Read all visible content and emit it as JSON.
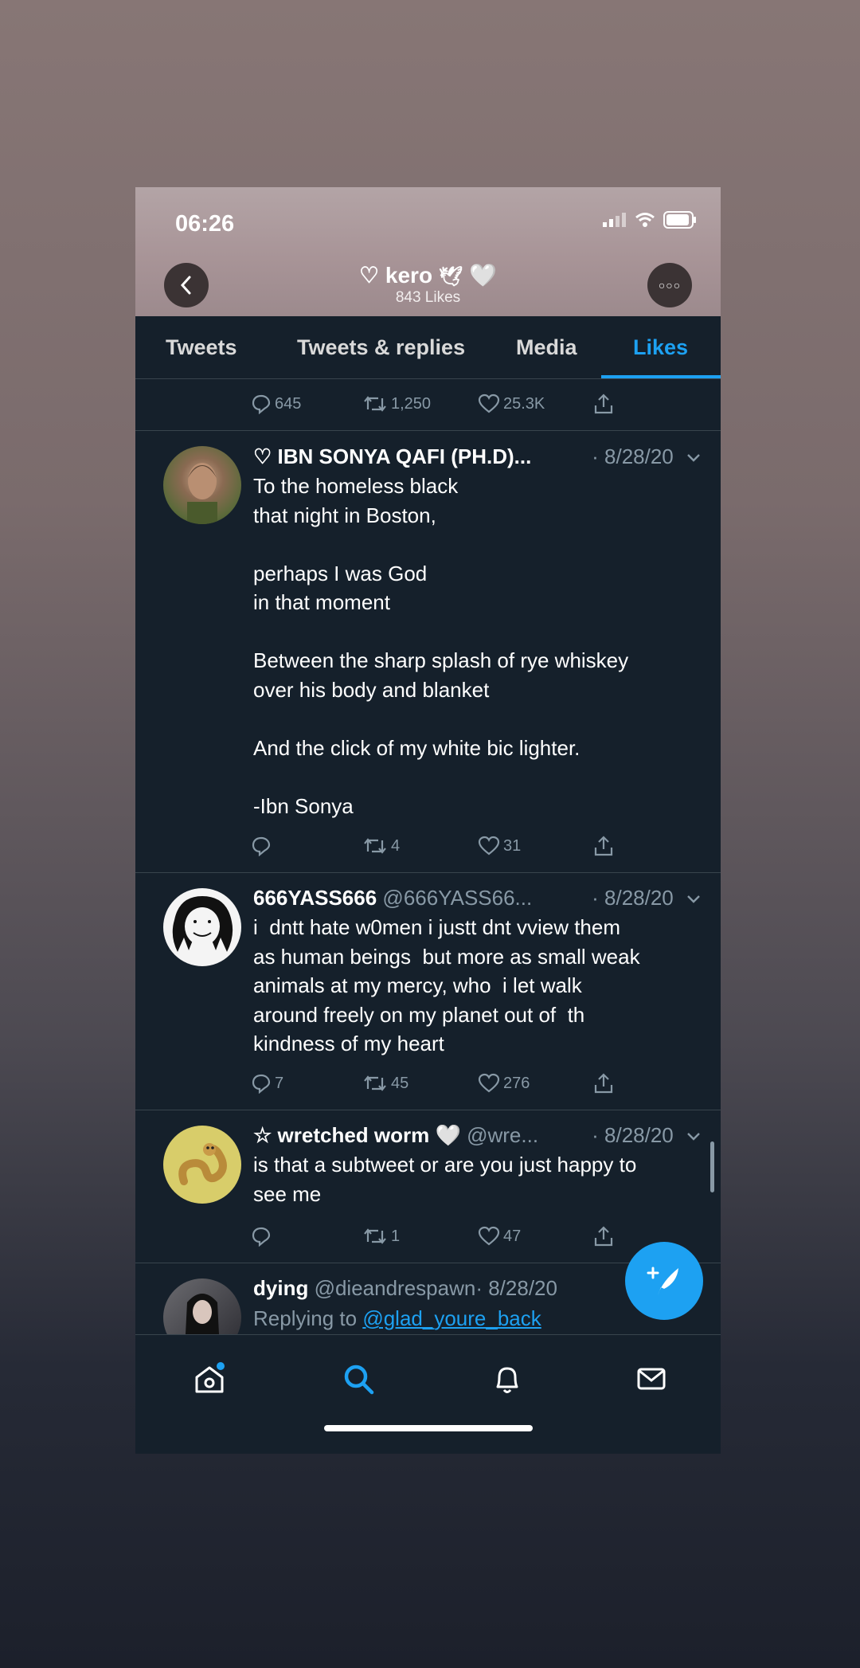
{
  "status": {
    "time": "06:26"
  },
  "profile": {
    "name": "♡ kero",
    "subtitle": "843 Likes"
  },
  "tabs": [
    {
      "label": "Tweets"
    },
    {
      "label": "Tweets & replies"
    },
    {
      "label": "Media"
    },
    {
      "label": "Likes"
    }
  ],
  "active_tab": "Likes",
  "top_actions": {
    "replies": "645",
    "retweets": "1,250",
    "likes": "25.3K"
  },
  "tweets": [
    {
      "name": "♡ IBN SONYA QAFI (PH.D)...",
      "handle": "",
      "date": "· 8/28/20",
      "text": "To the homeless black\nthat night in Boston,\n\nperhaps I was God\nin that moment\n\nBetween the sharp splash of rye whiskey\nover his body and blanket\n\nAnd the click of my white bic lighter.\n\n-Ibn Sonya",
      "replies": "",
      "retweets": "4",
      "likes": "31"
    },
    {
      "name": "666YASS666",
      "handle": "@666YASS66...",
      "date": "· 8/28/20",
      "text": "i  dntt hate w0men i justt dnt vview them\nas human beings  but more as small weak\nanimals at my mercy, who  i let walk\naround freely on my planet out of  th\nkindness of my heart",
      "replies": "7",
      "retweets": "45",
      "likes": "276"
    },
    {
      "name": "☆ wretched worm 🤍",
      "handle": "@wre...",
      "date": "· 8/28/20",
      "text": "is that a subtweet or are you just happy to\nsee me",
      "replies": "",
      "retweets": "1",
      "likes": "47"
    },
    {
      "name": "dying",
      "handle": "@dieandrespawn",
      "date": "· 8/28/20",
      "reply_prefix": "Replying to ",
      "reply_to": "@glad_youre_back"
    }
  ],
  "colors": {
    "accent": "#1da1f2",
    "background": "#15202b",
    "muted": "#8899a6"
  }
}
